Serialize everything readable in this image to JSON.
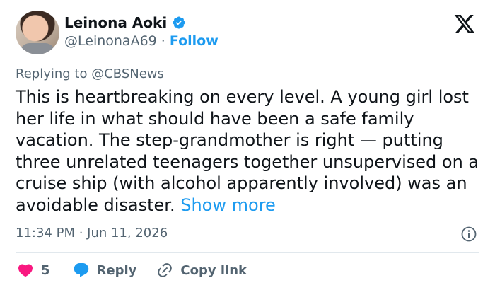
{
  "author": {
    "name": "Leinona Aoki",
    "handle": "@LeinonaA69",
    "separator": "·",
    "follow_label": "Follow"
  },
  "reply_context": {
    "prefix": "Replying to",
    "mention": "@CBSNews"
  },
  "tweet": {
    "text": "This is heartbreaking on every level. A young girl lost her life in what should have been a safe family vacation. The step-grandmother is right — putting three unrelated teenagers together unsupervised on a cruise ship (with alcohol apparently involved) was an avoidable disaster.",
    "show_more_label": "Show more",
    "timestamp": "11:34 PM · Jun 11, 2026"
  },
  "actions": {
    "like_count": "5",
    "reply_label": "Reply",
    "copy_link_label": "Copy link"
  },
  "colors": {
    "accent": "#1d9bf0",
    "like": "#f91880",
    "muted": "#536471",
    "text": "#0f1419"
  },
  "icons": {
    "verified": "verified-badge-icon",
    "brand": "x-logo-icon",
    "info": "info-icon",
    "like": "heart-icon",
    "reply": "reply-bubble-icon",
    "copy_link": "link-icon"
  }
}
